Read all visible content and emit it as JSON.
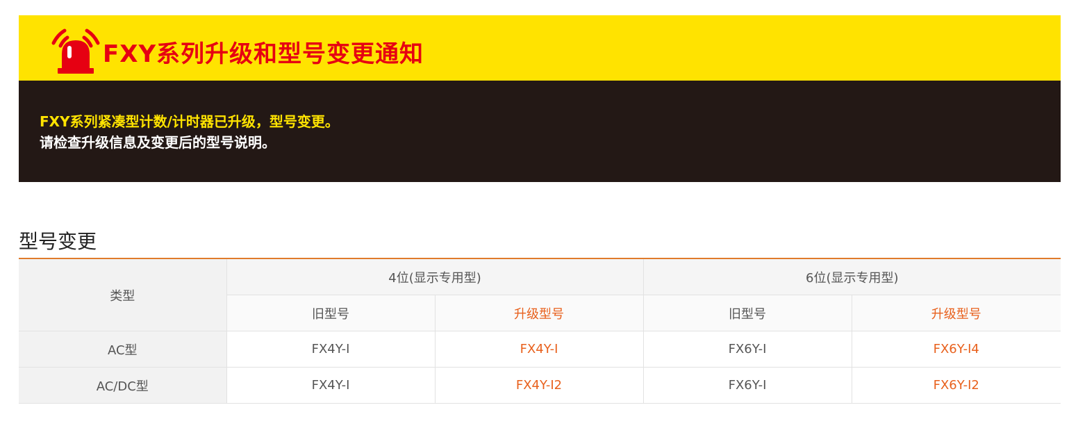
{
  "notice": {
    "title": "FXY系列升级和型号变更通知",
    "line1": "FXY系列紧凑型计数/计时器已升级，型号变更。",
    "line2": "请检查升级信息及变更后的型号说明。",
    "icon": "siren-icon"
  },
  "section": {
    "title": "型号变更"
  },
  "table": {
    "type_header": "类型",
    "groups": [
      "4位(显示专用型)",
      "6位(显示专用型)"
    ],
    "sub_headers": [
      "旧型号",
      "升级型号",
      "旧型号",
      "升级型号"
    ],
    "rows": [
      {
        "type": "AC型",
        "cells": [
          "FX4Y-I",
          "FX4Y-I",
          "FX6Y-I",
          "FX6Y-I4"
        ]
      },
      {
        "type": "AC/DC型",
        "cells": [
          "FX4Y-I",
          "FX4Y-I2",
          "FX6Y-I",
          "FX6Y-I2"
        ]
      }
    ]
  },
  "colors": {
    "notice_yellow": "#ffe300",
    "notice_dark": "#231815",
    "title_red": "#e60012",
    "accent_orange": "#e8601c"
  }
}
